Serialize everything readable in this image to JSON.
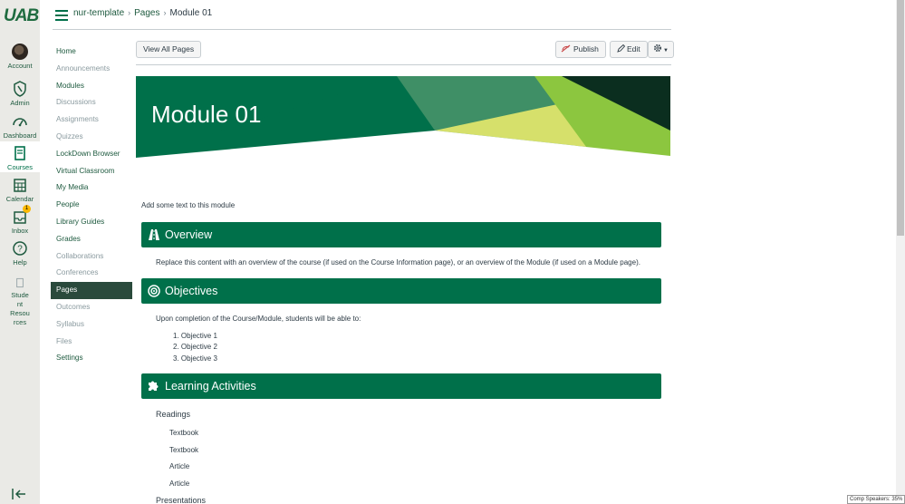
{
  "logo_text": "UAB",
  "global_nav": [
    {
      "label": "Account",
      "icon": "account-avatar"
    },
    {
      "label": "Admin",
      "icon": "shield-icon"
    },
    {
      "label": "Dashboard",
      "icon": "dashboard-icon"
    },
    {
      "label": "Courses",
      "icon": "book-icon"
    },
    {
      "label": "Calendar",
      "icon": "calendar-icon"
    },
    {
      "label": "Inbox",
      "icon": "inbox-icon",
      "badge": "1"
    },
    {
      "label": "Help",
      "icon": "help-icon"
    },
    {
      "label": "Stude\nnt\nResou\nrces",
      "icon": "page-icon"
    }
  ],
  "breadcrumb": {
    "course": "nur-template",
    "section": "Pages",
    "current": "Module 01"
  },
  "course_nav": [
    {
      "label": "Home",
      "state": "normal"
    },
    {
      "label": "Announcements",
      "state": "dim"
    },
    {
      "label": "Modules",
      "state": "normal"
    },
    {
      "label": "Discussions",
      "state": "dim"
    },
    {
      "label": "Assignments",
      "state": "dim"
    },
    {
      "label": "Quizzes",
      "state": "dim"
    },
    {
      "label": "LockDown Browser",
      "state": "normal"
    },
    {
      "label": "Virtual Classroom",
      "state": "normal"
    },
    {
      "label": "My Media",
      "state": "normal"
    },
    {
      "label": "People",
      "state": "normal"
    },
    {
      "label": "Library Guides",
      "state": "normal"
    },
    {
      "label": "Grades",
      "state": "normal"
    },
    {
      "label": "Collaborations",
      "state": "dim"
    },
    {
      "label": "Conferences",
      "state": "dim"
    },
    {
      "label": "Pages",
      "state": "active"
    },
    {
      "label": "Outcomes",
      "state": "dim"
    },
    {
      "label": "Syllabus",
      "state": "dim"
    },
    {
      "label": "Files",
      "state": "dim"
    },
    {
      "label": "Settings",
      "state": "normal"
    }
  ],
  "toolbar": {
    "view_all": "View All Pages",
    "publish": "Publish",
    "edit": "Edit"
  },
  "banner": {
    "title": "Module 01",
    "colors": {
      "green": "#00704a",
      "light": "#d6e06b",
      "lime": "#8cc63f",
      "dark": "#0b2e1f"
    }
  },
  "content": {
    "intro": "Add some text to this module",
    "overview": {
      "title": "Overview",
      "text": "Replace this content with an overview of the course (if used on the Course Information page), or an overview of the Module (if used on a Module page)."
    },
    "objectives": {
      "title": "Objectives",
      "text": "Upon completion of the Course/Module, students will be able to:",
      "items": [
        "1. Objective 1",
        "2. Objective 2",
        "3. Objective 3"
      ]
    },
    "activities": {
      "title": "Learning Activities",
      "readings_label": "Readings",
      "readings": [
        "Textbook",
        "Textbook",
        "Article",
        "Article"
      ],
      "presentations_label": "Presentations"
    }
  },
  "tooltip": "Comp Speakers: 35%"
}
